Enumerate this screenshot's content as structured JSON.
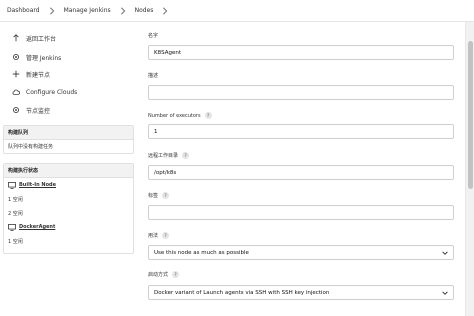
{
  "breadcrumb": [
    "Dashboard",
    "Manage Jenkins",
    "Nodes"
  ],
  "sidebar": {
    "items": [
      {
        "label": "返回工作台",
        "icon": "arrow-up-icon"
      },
      {
        "label": "管理 Jenkins",
        "icon": "gear-icon"
      },
      {
        "label": "新建节点",
        "icon": "plus-icon"
      },
      {
        "label": "Configure Clouds",
        "icon": "cloud-icon"
      },
      {
        "label": "节点监控",
        "icon": "gear-icon"
      }
    ]
  },
  "build_queue": {
    "title": "构建队列",
    "empty_text": "队列中没有构建任务"
  },
  "executor_status": {
    "title": "构建执行状态",
    "nodes": [
      {
        "name": "Built-In Node",
        "executors": [
          "1  空闲",
          "2  空闲"
        ]
      },
      {
        "name": "DockerAgent",
        "executors": [
          "1  空闲"
        ]
      }
    ]
  },
  "form": {
    "name_label": "名字",
    "name_value": "K8SAgent",
    "description_label": "描述",
    "description_value": "",
    "executors_label": "Number of executors",
    "executors_value": "1",
    "remote_root_label": "远程工作目录",
    "remote_root_value": "/opt/k8s",
    "labels_label": "标签",
    "labels_value": "",
    "usage_label": "用法",
    "usage_value": "Use this node as much as possible",
    "launch_label": "启动方式",
    "launch_value": "Docker variant of Launch agents via SSH with SSH key injection",
    "help_glyph": "?"
  }
}
